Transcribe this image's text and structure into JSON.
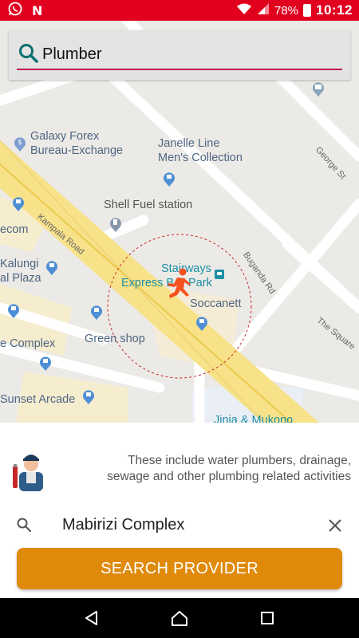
{
  "status_bar": {
    "battery": "78%",
    "time": "10:12",
    "icons": [
      "whatsapp-icon",
      "n-icon",
      "wifi-icon",
      "signal-icon",
      "battery-icon"
    ]
  },
  "search": {
    "value": "Plumber",
    "accent_color": "#c2185b"
  },
  "map": {
    "pois": [
      {
        "label_lines": [
          "Galaxy Forex",
          "Bureau-Exchange"
        ],
        "icon": "dollar-pin-icon"
      },
      {
        "label_lines": [
          "Janelle Line",
          "Men's Collection"
        ],
        "icon": "shop-pin-icon"
      },
      {
        "label_lines": [
          "Shell Fuel station"
        ],
        "icon": "fuel-pin-icon"
      },
      {
        "label_lines": [
          "ecom"
        ],
        "icon": ""
      },
      {
        "label_lines": [
          "Kalungi",
          "al Plaza"
        ],
        "icon": "shop-pin-icon"
      },
      {
        "label_lines": [
          "Stairways",
          "Express B",
          "Park"
        ],
        "icon": "bus-icon"
      },
      {
        "label_lines": [
          "Soccanett"
        ],
        "icon": "shop-pin-icon"
      },
      {
        "label_lines": [
          "Green shop"
        ],
        "icon": "shop-pin-icon"
      },
      {
        "label_lines": [
          "e Complex"
        ],
        "icon": "shop-pin-icon"
      },
      {
        "label_lines": [
          "Sunset Arcade"
        ],
        "icon": "shop-pin-icon"
      },
      {
        "label_lines": [
          "Jinja & Mukono"
        ],
        "icon": "bus-icon"
      }
    ],
    "streets": [
      "Kampala Road",
      "Buganda Rd",
      "George St",
      "The Square"
    ],
    "runner_icon": "running-person-icon",
    "runner_color": "#f4511e"
  },
  "panel": {
    "description_line1": "These include water plumbers, drainage,",
    "description_line2": "sewage and other plumbing related activities",
    "location_value": "Mabirizi Complex",
    "button_label": "SEARCH PROVIDER",
    "button_color": "#e08a0b"
  },
  "nav": {
    "buttons": [
      "back-icon",
      "home-icon",
      "recents-icon"
    ]
  }
}
